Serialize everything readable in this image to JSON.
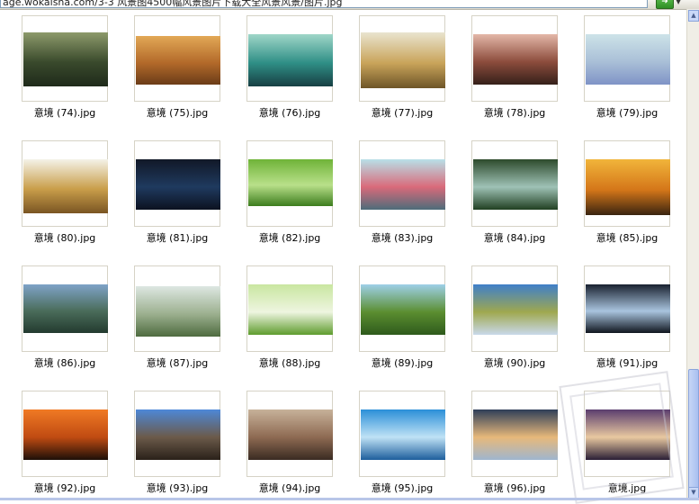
{
  "address_bar": {
    "value": "age.wokaisha.com/3-3 风景图4500幅风景图片下载大全风景风景/图片.jpg"
  },
  "go_label": "➜",
  "thumbnails": [
    {
      "label": "意境 (74).jpg",
      "colors": [
        "#8d9a6b",
        "#3a4a2c",
        "#1f2a1a"
      ]
    },
    {
      "label": "意境 (75).jpg",
      "colors": [
        "#e2a856",
        "#b36a2a",
        "#6b3c18"
      ]
    },
    {
      "label": "意境 (76).jpg",
      "colors": [
        "#9fd6c8",
        "#2f8f86",
        "#173f43"
      ]
    },
    {
      "label": "意境 (77).jpg",
      "colors": [
        "#e9e4cf",
        "#c9a45a",
        "#6e5528"
      ]
    },
    {
      "label": "意境 (78).jpg",
      "colors": [
        "#e3b7a8",
        "#8c4c3c",
        "#35201a"
      ]
    },
    {
      "label": "意境 (79).jpg",
      "colors": [
        "#cde3e8",
        "#a9bfd7",
        "#7f93c6"
      ]
    },
    {
      "label": "意境 (80).jpg",
      "colors": [
        "#f4f2e8",
        "#c99e4a",
        "#7a5523"
      ]
    },
    {
      "label": "意境 (81).jpg",
      "colors": [
        "#111827",
        "#1f3a5f",
        "#0c1220"
      ]
    },
    {
      "label": "意境 (82).jpg",
      "colors": [
        "#6fb338",
        "#b9e08a",
        "#3d7d1e"
      ]
    },
    {
      "label": "意境 (83).jpg",
      "colors": [
        "#b8e0e8",
        "#d96a7a",
        "#4d6c7a"
      ]
    },
    {
      "label": "意境 (84).jpg",
      "colors": [
        "#2d4a2b",
        "#9fc2b6",
        "#214021"
      ]
    },
    {
      "label": "意境 (85).jpg",
      "colors": [
        "#f1b53b",
        "#d47619",
        "#3a2410"
      ]
    },
    {
      "label": "意境 (86).jpg",
      "colors": [
        "#7fa3c8",
        "#4a6c5a",
        "#233a2f"
      ]
    },
    {
      "label": "意境 (87).jpg",
      "colors": [
        "#dde7e2",
        "#9cb08f",
        "#4e6b3f"
      ]
    },
    {
      "label": "意境 (88).jpg",
      "colors": [
        "#c9e6a0",
        "#eef5e0",
        "#5f9c2e"
      ]
    },
    {
      "label": "意境 (89).jpg",
      "colors": [
        "#9ed0e8",
        "#5b8e30",
        "#2e5a1c"
      ]
    },
    {
      "label": "意境 (90).jpg",
      "colors": [
        "#3f7fc9",
        "#9fa84f",
        "#c9d9ea"
      ]
    },
    {
      "label": "意境 (91).jpg",
      "colors": [
        "#1a2230",
        "#a9c4de",
        "#10161f"
      ]
    },
    {
      "label": "意境 (92).jpg",
      "colors": [
        "#f07a24",
        "#c04b12",
        "#1d0f08"
      ]
    },
    {
      "label": "意境 (93).jpg",
      "colors": [
        "#4d88d8",
        "#6b5a4a",
        "#2a2119"
      ]
    },
    {
      "label": "意境 (94).jpg",
      "colors": [
        "#c7b29a",
        "#8e6a52",
        "#3a2b22"
      ]
    },
    {
      "label": "意境 (95).jpg",
      "colors": [
        "#2a8fd8",
        "#bfe2f5",
        "#1d5e9c"
      ]
    },
    {
      "label": "意境 (96).jpg",
      "colors": [
        "#2e3e58",
        "#e7b87a",
        "#9fb6cf"
      ]
    },
    {
      "label": "意境.jpg",
      "colors": [
        "#5a3d6e",
        "#e8c8a0",
        "#2a1e35"
      ]
    }
  ]
}
